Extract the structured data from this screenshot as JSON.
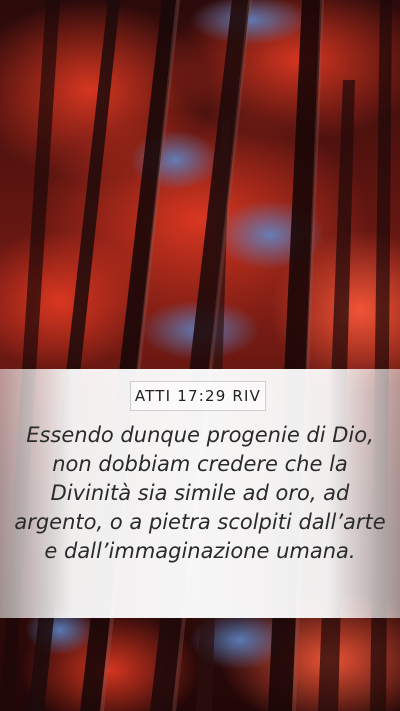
{
  "reference": "ATTI 17:29 RIV",
  "verse_text": "Essendo dunque progenie di Dio, non dobbiam credere che la Divinità sia simile ad oro, ad argento, o a pietra scolpiti dall’arte e dall’immaginazione umana.",
  "colors": {
    "foliage_red": "#c8281a",
    "sky_blue": "#4a78b8",
    "trunk_dark": "#1c0a0a",
    "panel_white": "#ffffff",
    "text_dark": "#2a2a2a"
  }
}
